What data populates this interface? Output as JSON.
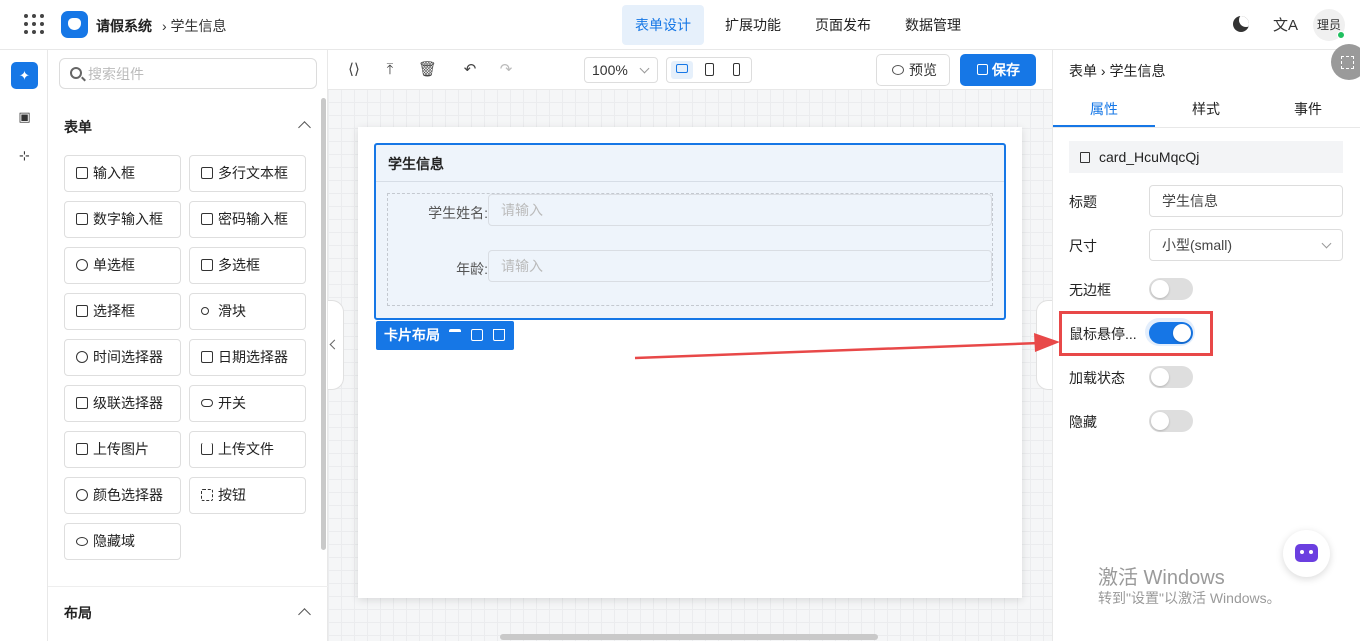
{
  "header": {
    "app_title": "请假系统",
    "breadcrumb": "› 学生信息",
    "nav": [
      {
        "label": "表单设计",
        "active": true
      },
      {
        "label": "扩展功能",
        "active": false
      },
      {
        "label": "页面发布",
        "active": false
      },
      {
        "label": "数据管理",
        "active": false
      }
    ],
    "avatar_text": "理员",
    "lang_glyph": "文A"
  },
  "rail": {
    "icons": [
      "puzzle-icon",
      "code-box-icon",
      "tree-icon"
    ]
  },
  "palette": {
    "search_placeholder": "搜索组件",
    "form_section_title": "表单",
    "layout_section_title": "布局",
    "components": [
      {
        "label": "输入框",
        "icon": "pencil-icon"
      },
      {
        "label": "多行文本框",
        "icon": "textarea-icon"
      },
      {
        "label": "数字输入框",
        "icon": "number-icon"
      },
      {
        "label": "密码输入框",
        "icon": "lock-icon"
      },
      {
        "label": "单选框",
        "icon": "radio-icon"
      },
      {
        "label": "多选框",
        "icon": "checkbox-icon"
      },
      {
        "label": "选择框",
        "icon": "select-icon"
      },
      {
        "label": "滑块",
        "icon": "slider-icon"
      },
      {
        "label": "时间选择器",
        "icon": "clock-icon"
      },
      {
        "label": "日期选择器",
        "icon": "calendar-icon"
      },
      {
        "label": "级联选择器",
        "icon": "cascader-icon"
      },
      {
        "label": "开关",
        "icon": "switch-icon"
      },
      {
        "label": "上传图片",
        "icon": "image-icon"
      },
      {
        "label": "上传文件",
        "icon": "upload-icon"
      },
      {
        "label": "颜色选择器",
        "icon": "palette-icon"
      },
      {
        "label": "按钮",
        "icon": "button-icon"
      },
      {
        "label": "隐藏域",
        "icon": "eye-off-icon"
      }
    ]
  },
  "toolbar": {
    "zoom": "100%",
    "preview_label": "预览",
    "save_label": "保存"
  },
  "canvas": {
    "card_title": "学生信息",
    "fields": [
      {
        "label": "学生姓名:",
        "placeholder": "请输入"
      },
      {
        "label": "年龄:",
        "placeholder": "请输入"
      }
    ],
    "card_tag_label": "卡片布局"
  },
  "props": {
    "breadcrumb": "表单 › 学生信息",
    "tabs": [
      {
        "label": "属性",
        "active": true
      },
      {
        "label": "样式",
        "active": false
      },
      {
        "label": "事件",
        "active": false
      }
    ],
    "component_id": "card_HcuMqcQj",
    "title_label": "标题",
    "title_value": "学生信息",
    "size_label": "尺寸",
    "size_value": "小型(small)",
    "toggles": [
      {
        "label": "无边框",
        "on": false
      },
      {
        "label": "鼠标悬停...",
        "on": true
      },
      {
        "label": "加载状态",
        "on": false
      },
      {
        "label": "隐藏",
        "on": false
      }
    ]
  },
  "watermark": {
    "line1": "激活 Windows",
    "line2": "转到\"设置\"以激活 Windows。"
  },
  "colors": {
    "accent": "#1677e6",
    "highlight": "#e84848"
  }
}
